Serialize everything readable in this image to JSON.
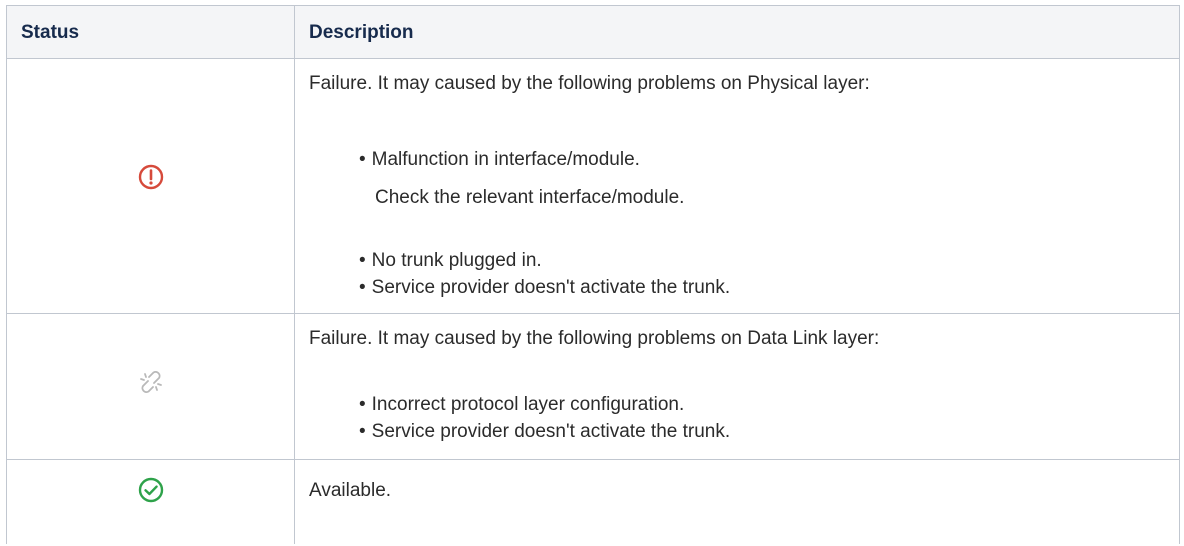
{
  "table": {
    "headers": {
      "status": "Status",
      "description": "Description"
    },
    "rows": [
      {
        "status_icon": "alert-circle-icon",
        "status_color": "#d64a3b",
        "intro": "Failure. It may caused by the following problems on Physical layer:",
        "bullets": [
          "Malfunction in interface/module.",
          "No trunk plugged in.",
          "Service provider doesn't activate the trunk."
        ],
        "sub_note": "Check the relevant interface/module."
      },
      {
        "status_icon": "broken-link-icon",
        "status_color": "#b9b9b9",
        "intro": "Failure. It may caused by the following problems on Data Link layer:",
        "bullets": [
          "Incorrect protocol layer configuration.",
          "Service provider doesn't activate the trunk."
        ]
      },
      {
        "status_icon": "check-circle-icon",
        "status_color": "#2ea24a",
        "intro": "Available."
      }
    ]
  },
  "bullet_char": "•"
}
